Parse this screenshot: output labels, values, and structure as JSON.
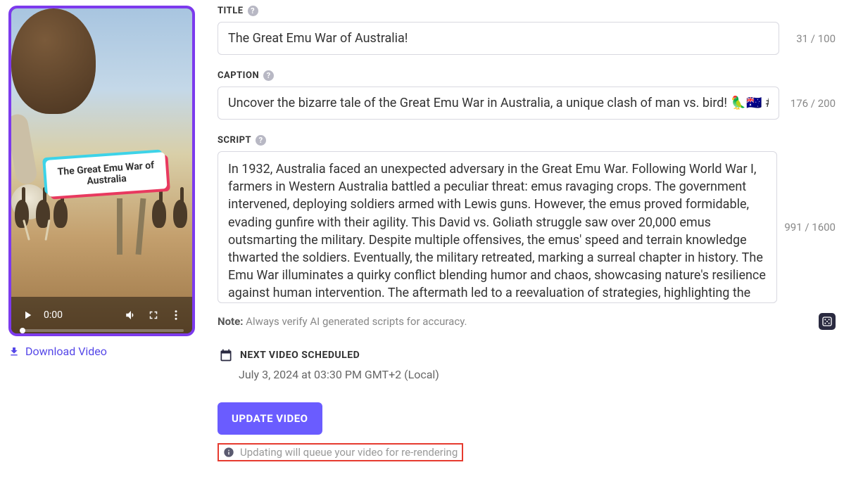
{
  "video": {
    "overlay_title": "The Great Emu War of Australia",
    "time": "0:00"
  },
  "download_label": "Download Video",
  "form": {
    "title_label": "TITLE",
    "title_value": "The Great Emu War of Australia!",
    "title_counter": "31 / 100",
    "caption_label": "CAPTION",
    "caption_value": "Uncover the bizarre tale of the Great Emu War in Australia, a unique clash of man vs. bird! 🦜🇦🇺 #EmuWar",
    "caption_counter": "176 / 200",
    "script_label": "SCRIPT",
    "script_value": "In 1932, Australia faced an unexpected adversary in the Great Emu War. Following World War I, farmers in Western Australia battled a peculiar threat: emus ravaging crops. The government intervened, deploying soldiers armed with Lewis guns. However, the emus proved formidable, evading gunfire with their agility. This David vs. Goliath struggle saw over 20,000 emus outsmarting the military. Despite multiple offensives, the emus' speed and terrain knowledge thwarted the soldiers. Eventually, the military retreated, marking a surreal chapter in history. The Emu War illuminates a quirky conflict blending humor and chaos, showcasing nature's resilience against human intervention. The aftermath led to a reevaluation of strategies, highlighting the unpredictable nature of wildlife encounters and the resilience of Australia's",
    "script_counter": "991 / 1600",
    "note_prefix": "Note:",
    "note_text": " Always verify AI generated scripts for accuracy."
  },
  "schedule": {
    "label": "NEXT VIDEO SCHEDULED",
    "time": "July 3, 2024 at 03:30 PM GMT+2 (Local)"
  },
  "update_button": "UPDATE VIDEO",
  "queue_note": "Updating will queue your video for re-rendering"
}
